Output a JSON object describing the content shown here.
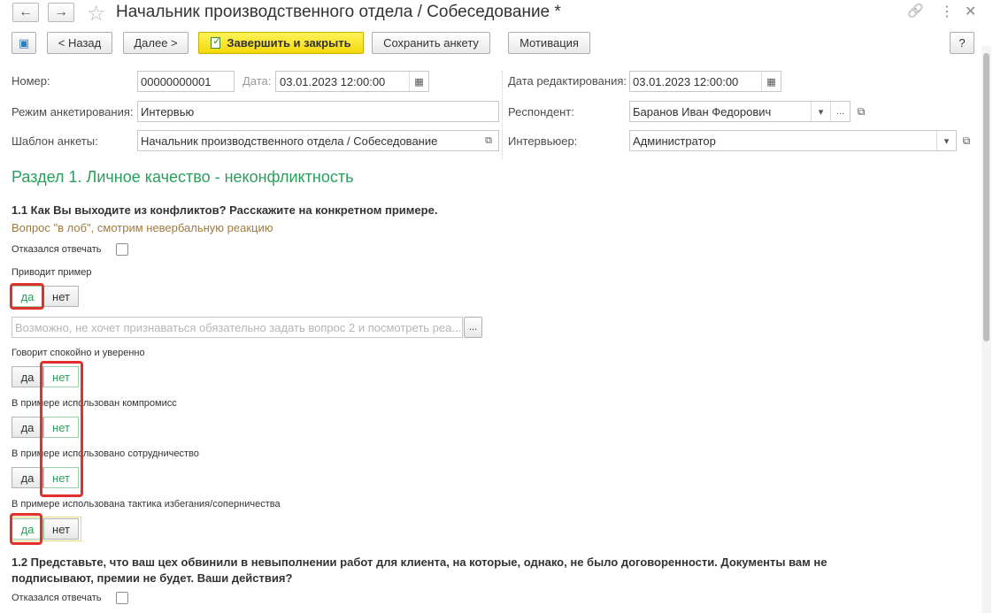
{
  "window": {
    "title": "Начальник производственного отдела / Собеседование *",
    "back_icon": "←",
    "forward_icon": "→",
    "star_icon": "☆",
    "link_icon": "🔗",
    "more_icon": "⋮",
    "close_icon": "✕"
  },
  "toolbar": {
    "save_icon": "▣",
    "back_label": "< Назад",
    "next_label": "Далее >",
    "finish_label": "Завершить и закрыть",
    "save_survey_label": "Сохранить анкету",
    "motivation_label": "Мотивация",
    "help_label": "?"
  },
  "form": {
    "number_label": "Номер:",
    "number_value": "00000000001",
    "date_label": "Дата:",
    "date_value": "03.01.2023 12:00:00",
    "edit_date_label": "Дата редактирования:",
    "edit_date_value": "03.01.2023 12:00:00",
    "mode_label": "Режим анкетирования:",
    "mode_value": "Интервью",
    "respondent_label": "Респондент:",
    "respondent_value": "Баранов Иван Федорович",
    "template_label": "Шаблон анкеты:",
    "template_value": "Начальник производственного отдела / Собеседование",
    "interviewer_label": "Интервьюер:",
    "interviewer_value": "Администратор",
    "calendar_icon": "▦",
    "dropdown_icon": "▾",
    "ellipsis_icon": "...",
    "open_icon": "⧉"
  },
  "section": {
    "title": "Раздел 1. Личное качество - неконфликтность"
  },
  "q1": {
    "text": "1.1 Как Вы выходите из конфликтов? Расскажите на конкретном примере.",
    "hint": "Вопрос \"в лоб\", смотрим невербальную реакцию",
    "refused_label": "Отказался отвечать",
    "items": [
      {
        "label": "Приводит пример",
        "yes": "да",
        "no": "нет",
        "selected": "yes"
      },
      {
        "label": "Говорит спокойно и уверенно",
        "yes": "да",
        "no": "нет",
        "selected": "no"
      },
      {
        "label": "В примере использован компромисс",
        "yes": "да",
        "no": "нет",
        "selected": "no"
      },
      {
        "label": "В примере использовано сотрудничество",
        "yes": "да",
        "no": "нет",
        "selected": "no"
      },
      {
        "label": "В примере использована тактика избегания/соперничества",
        "yes": "да",
        "no": "нет",
        "selected": "yes"
      }
    ],
    "comment_placeholder": "Возможно, не хочет признаваться обязательно задать вопрос 2 и посмотреть реа..."
  },
  "q2": {
    "text": "1.2 Представьте, что ваш цех обвинили в невыполнении работ для клиента, на которые, однако, не было договоренности. Документы вам не подписывают, премии не будет. Ваши действия?",
    "refused_label": "Отказался отвечать"
  },
  "colors": {
    "accent_green": "#2a9f5c",
    "highlight_red": "#e0312d",
    "primary_yellow": "#f4d90b",
    "hint_brown": "#a07a3c"
  }
}
